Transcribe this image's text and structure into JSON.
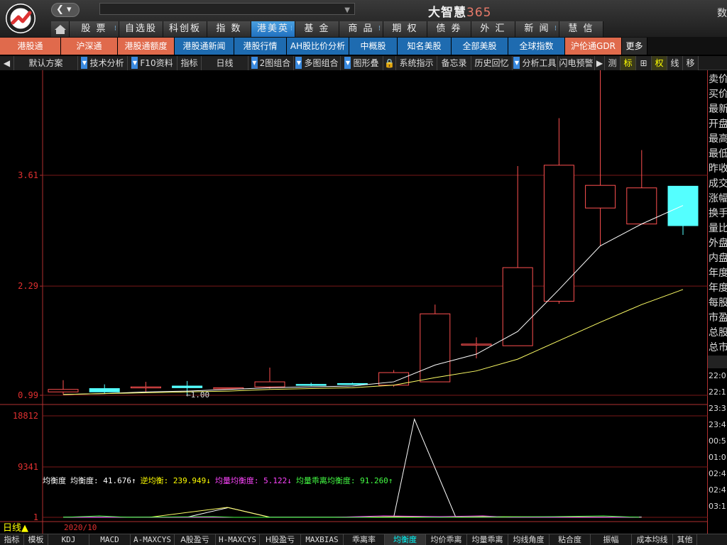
{
  "app": {
    "brand_text": "大智慧",
    "brand_num": "365",
    "right_glyph": "数"
  },
  "search": {
    "value": ""
  },
  "mainnav": {
    "items": [
      {
        "label": "股 票",
        "w": 70,
        "dot": true
      },
      {
        "label": "自选股",
        "w": 62
      },
      {
        "label": "科创板",
        "w": 62
      },
      {
        "label": "指 数",
        "w": 62
      },
      {
        "label": "港美英",
        "w": 62,
        "active": true,
        "dot": true
      },
      {
        "label": "基 金",
        "w": 62
      },
      {
        "label": "商 品",
        "w": 62,
        "dot": true
      },
      {
        "label": "期 权",
        "w": 62
      },
      {
        "label": "债 券",
        "w": 62
      },
      {
        "label": "外 汇",
        "w": 62
      },
      {
        "label": "新 闻",
        "w": 62,
        "dot": true
      },
      {
        "label": "慧 信",
        "w": 62
      }
    ]
  },
  "subnav": {
    "items": [
      {
        "label": "港股通",
        "w": 86,
        "c": "o"
      },
      {
        "label": "沪深通",
        "w": 80,
        "c": "o"
      },
      {
        "label": "港股通额度",
        "w": 80,
        "c": "o"
      },
      {
        "label": "港股通新闻",
        "w": 84,
        "c": "b"
      },
      {
        "label": "港股行情",
        "w": 74,
        "c": "b"
      },
      {
        "label": "AH股比价分析",
        "w": 88,
        "c": "b"
      },
      {
        "label": "中概股",
        "w": 68,
        "c": "b"
      },
      {
        "label": "知名美股",
        "w": 76,
        "c": "b"
      },
      {
        "label": "全部美股",
        "w": 80,
        "c": "b"
      },
      {
        "label": "全球指数",
        "w": 80,
        "c": "b"
      },
      {
        "label": "沪伦通GDR",
        "w": 80,
        "c": "o"
      },
      {
        "label": "更多",
        "w": 36,
        "c": "d"
      }
    ]
  },
  "toolbar": {
    "items": [
      {
        "label": "◀",
        "w": 20
      },
      {
        "label": "默认方案",
        "w": 90,
        "dd": false
      },
      {
        "label": "技术分析",
        "w": 70,
        "dd": true
      },
      {
        "label": "F10资料",
        "w": 70,
        "dd": true
      },
      {
        "label": "指标",
        "w": 34
      },
      {
        "label": "日线",
        "w": 66,
        "dd": false
      },
      {
        "label": "2图组合",
        "w": 64,
        "dd": true
      },
      {
        "label": "多图组合",
        "w": 66,
        "dd": true
      },
      {
        "label": "图形叠加",
        "w": 60,
        "dd": true
      },
      {
        "label": "🔒",
        "w": 18
      },
      {
        "label": "系统指示",
        "w": 58
      },
      {
        "label": "备忘录",
        "w": 48
      },
      {
        "label": "历史回忆",
        "w": 58
      },
      {
        "label": "分析工具",
        "w": 64,
        "dd": true
      },
      {
        "label": "闪电预警",
        "w": 52
      },
      {
        "label": "▶",
        "w": 14
      },
      {
        "label": "测",
        "w": 22
      },
      {
        "label": "标",
        "w": 22,
        "hl": true
      },
      {
        "label": "⊞",
        "w": 22
      },
      {
        "label": "权",
        "w": 22,
        "hl": true
      },
      {
        "label": "线",
        "w": 22
      },
      {
        "label": "移",
        "w": 22
      }
    ]
  },
  "chart_data": {
    "type": "candlestick",
    "price_ticks": [
      "3.61",
      "2.29",
      "0.99"
    ],
    "price_range": [
      0.99,
      3.61
    ],
    "min_marker": "←1.00",
    "candles": [
      {
        "o": 1.03,
        "c": 1.06,
        "h": 1.17,
        "l": 1.0
      },
      {
        "o": 1.07,
        "c": 1.03,
        "h": 1.12,
        "l": 1.01
      },
      {
        "o": 1.08,
        "c": 1.09,
        "h": 1.15,
        "l": 1.03
      },
      {
        "o": 1.1,
        "c": 1.08,
        "h": 1.16,
        "l": 1.0
      },
      {
        "o": 1.08,
        "c": 1.08,
        "h": 1.08,
        "l": 1.08
      },
      {
        "o": 1.09,
        "c": 1.15,
        "h": 1.32,
        "l": 1.07
      },
      {
        "o": 1.12,
        "c": 1.11,
        "h": 1.14,
        "l": 1.1
      },
      {
        "o": 1.13,
        "c": 1.12,
        "h": 1.14,
        "l": 1.12
      },
      {
        "o": 1.11,
        "c": 1.26,
        "h": 1.29,
        "l": 1.09
      },
      {
        "o": 1.15,
        "c": 1.96,
        "h": 2.07,
        "l": 1.15
      },
      {
        "o": 1.6,
        "c": 1.6,
        "h": 1.68,
        "l": 1.43
      },
      {
        "o": 1.58,
        "c": 2.51,
        "h": 3.72,
        "l": 1.58
      },
      {
        "o": 2.11,
        "c": 3.73,
        "h": 4.29,
        "l": 2.08
      },
      {
        "o": 3.22,
        "c": 3.49,
        "h": 4.92,
        "l": 2.77
      },
      {
        "o": 3.03,
        "c": 3.46,
        "h": 3.91,
        "l": 3.03
      },
      {
        "o": 3.48,
        "c": 3.01,
        "h": 3.48,
        "l": 2.9
      }
    ],
    "ma_white": [
      1.0,
      1.01,
      1.03,
      1.04,
      1.06,
      1.08,
      1.09,
      1.1,
      1.15,
      1.35,
      1.48,
      1.75,
      2.25,
      2.77,
      3.03,
      3.25
    ],
    "ma_yellow": [
      1.0,
      1.01,
      1.02,
      1.03,
      1.04,
      1.06,
      1.07,
      1.08,
      1.11,
      1.2,
      1.28,
      1.42,
      1.64,
      1.86,
      2.07,
      2.25
    ],
    "indicator": {
      "title": "均衡度",
      "labels": [
        {
          "text": "均衡度: 41.676↑",
          "color": "#ffffff"
        },
        {
          "text": "逆均衡: 239.949↓",
          "color": "#ffff00"
        },
        {
          "text": "均量均衡度: 5.122↓",
          "color": "#ff44ff"
        },
        {
          "text": "均量乖离均衡度: 91.260↑",
          "color": "#44ff44"
        }
      ],
      "ticks": [
        "18812",
        "9341",
        "1"
      ],
      "range": [
        1,
        18812
      ],
      "white": [
        40,
        40,
        40,
        40,
        1800,
        40,
        40,
        40,
        40,
        18200,
        40,
        40,
        40,
        40,
        40,
        40
      ],
      "white_x": [
        0,
        1,
        2,
        3,
        4,
        5,
        6,
        7,
        8,
        8.5,
        9.5,
        10,
        11,
        12,
        13,
        14
      ],
      "lines_small": true
    },
    "x_label": "2020/10"
  },
  "side": {
    "labels": [
      "卖价",
      "买价",
      "最新",
      "开盘",
      "最高",
      "最低",
      "昨收",
      "成交",
      "涨幅",
      "换手",
      "量比",
      "外盘",
      "内盘",
      "年度",
      "年度",
      "每股",
      "市盈",
      "总股",
      "总市"
    ],
    "times": [
      "22:0",
      "22:1",
      "23:3",
      "23:4",
      "00:5",
      "01:0",
      "02:4",
      "02:4",
      "03:1"
    ]
  },
  "bottom": {
    "period_label": "日线▲",
    "items": [
      {
        "label": "指标",
        "w": 34,
        "zh": true
      },
      {
        "label": "模板",
        "w": 34,
        "zh": true
      },
      {
        "label": "KDJ",
        "w": 58
      },
      {
        "label": "MACD",
        "w": 58
      },
      {
        "label": "A-MAXCYS",
        "w": 62
      },
      {
        "label": "A股盈亏",
        "w": 58,
        "zh": true
      },
      {
        "label": "H-MAXCYS",
        "w": 62
      },
      {
        "label": "H股盈亏",
        "w": 58,
        "zh": true
      },
      {
        "label": "MAXBIAS",
        "w": 60
      },
      {
        "label": "乖离率",
        "w": 58,
        "zh": true
      },
      {
        "label": "均衡度",
        "w": 58,
        "zh": true,
        "act": true
      },
      {
        "label": "均价乖离",
        "w": 58,
        "zh": true
      },
      {
        "label": "均量乖离",
        "w": 58,
        "zh": true
      },
      {
        "label": "均线角度",
        "w": 58,
        "zh": true
      },
      {
        "label": "粘合度",
        "w": 58,
        "zh": true
      },
      {
        "label": "振幅",
        "w": 58,
        "zh": true
      },
      {
        "label": "成本均线",
        "w": 58,
        "zh": true
      },
      {
        "label": "其他",
        "w": 34,
        "zh": true
      }
    ]
  }
}
